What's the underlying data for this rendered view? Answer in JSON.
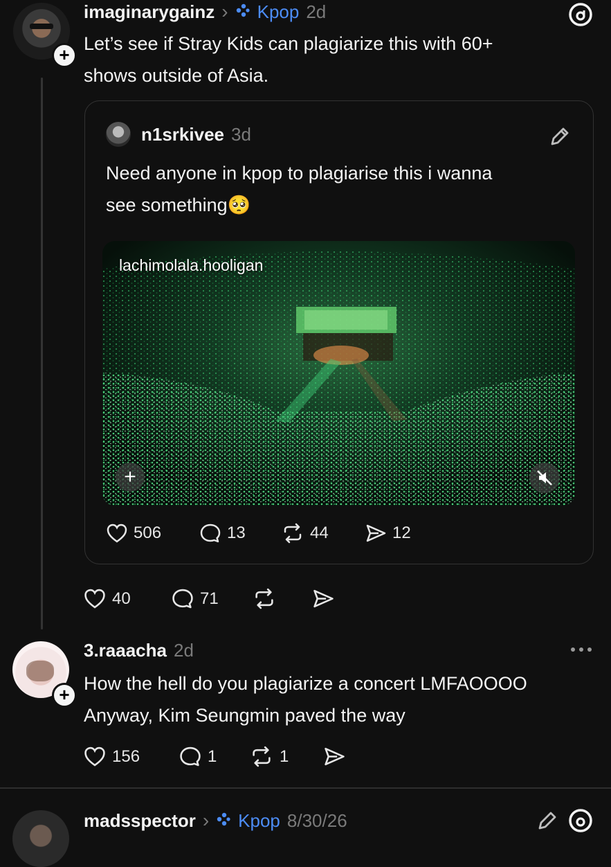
{
  "post1": {
    "username": "imaginarygainz",
    "separator": "›",
    "community": "Kpop",
    "time": "2d",
    "text_line1": "Let’s see if Stray Kids can plagiarize this with 60+",
    "text_line2": "shows outside of Asia.",
    "stats": {
      "likes": "40",
      "replies": "71"
    }
  },
  "quote": {
    "username": "n1srkivee",
    "time": "3d",
    "text_line1": "Need anyone in kpop to plagiarise this i wanna",
    "text_line2": "see something🥺",
    "media_watermark": "lachimolala.hooligan",
    "stats": {
      "likes": "506",
      "replies": "13",
      "reposts": "44",
      "shares": "12"
    }
  },
  "post2": {
    "username": "3.raaacha",
    "time": "2d",
    "text_line1": "How the hell do you plagiarize a concert LMFAOOOO",
    "text_line2": "Anyway, Kim Seungmin paved the way",
    "stats": {
      "likes": "156",
      "replies": "1",
      "reposts": "1"
    }
  },
  "post3": {
    "username": "madsspector",
    "separator": "›",
    "community": "Kpop",
    "time": "8/30/26"
  },
  "icons": {
    "threads": "threads-logo-icon",
    "community": "community-dots-icon",
    "more": "more-icon",
    "edit": "edit-pencil-icon",
    "mute": "mute-icon"
  },
  "colors": {
    "accent_blue": "#4c8cf5",
    "background": "#101010"
  }
}
